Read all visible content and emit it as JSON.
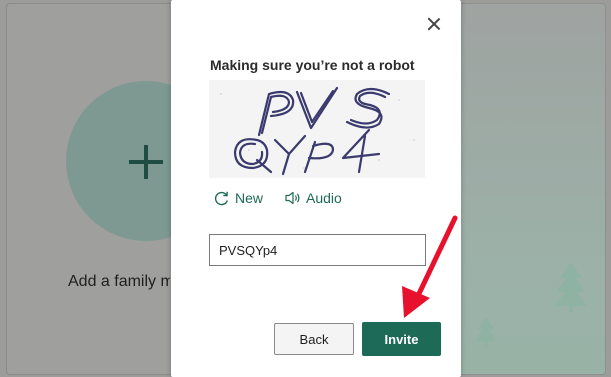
{
  "background": {
    "add_label": "Add a family m"
  },
  "dialog": {
    "title": "Making sure you’re not a robot",
    "captcha_text": "PVSQYp4",
    "new_label": "New",
    "audio_label": "Audio",
    "input_value": "PVSQYp4",
    "back_label": "Back",
    "invite_label": "Invite"
  },
  "colors": {
    "accent": "#1d6b56",
    "annotation": "#e8112d"
  },
  "icons": {
    "close": "close-icon",
    "refresh": "refresh-icon",
    "speaker": "speaker-icon",
    "plus": "plus-icon"
  }
}
